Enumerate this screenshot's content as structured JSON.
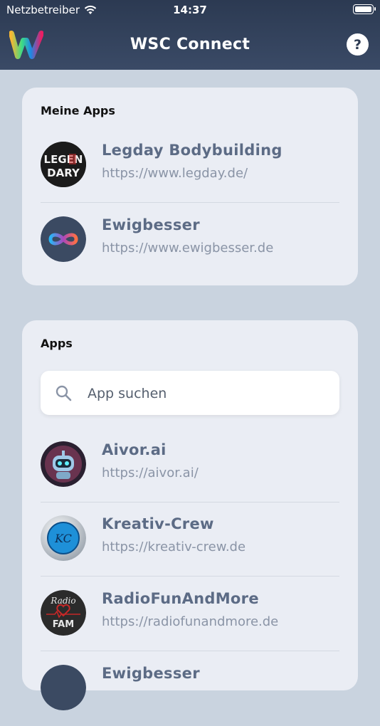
{
  "status_bar": {
    "carrier": "Netzbetreiber",
    "time": "14:37"
  },
  "header": {
    "title": "WSC Connect",
    "help_label": "?"
  },
  "my_apps": {
    "title": "Meine Apps",
    "items": [
      {
        "name": "Legday Bodybuilding",
        "url": "https://www.legday.de/",
        "icon": "legday-logo",
        "logo_text_top": "LEGEN",
        "logo_text_bottom": "DARY"
      },
      {
        "name": "Ewigbesser",
        "url": "https://www.ewigbesser.de",
        "icon": "infinity-logo"
      }
    ]
  },
  "apps": {
    "title": "Apps",
    "search_placeholder": "App suchen",
    "items": [
      {
        "name": "Aivor.ai",
        "url": "https://aivor.ai/",
        "icon": "robot-logo"
      },
      {
        "name": "Kreativ-Crew",
        "url": "https://kreativ-crew.de",
        "icon": "kreativ-crew-logo",
        "logo_text": "KC"
      },
      {
        "name": "RadioFunAndMore",
        "url": "https://radiofunandmore.de",
        "icon": "radio-logo",
        "logo_text_top": "Radio",
        "logo_text_bottom": "FAM"
      },
      {
        "name": "Ewigbesser",
        "url": "",
        "icon": "infinity-logo"
      }
    ]
  },
  "colors": {
    "header": "#2c3a52",
    "background": "#c9d3df",
    "card": "#eaedf4",
    "item_name": "#5c6b85",
    "item_url": "#8a94a6"
  }
}
